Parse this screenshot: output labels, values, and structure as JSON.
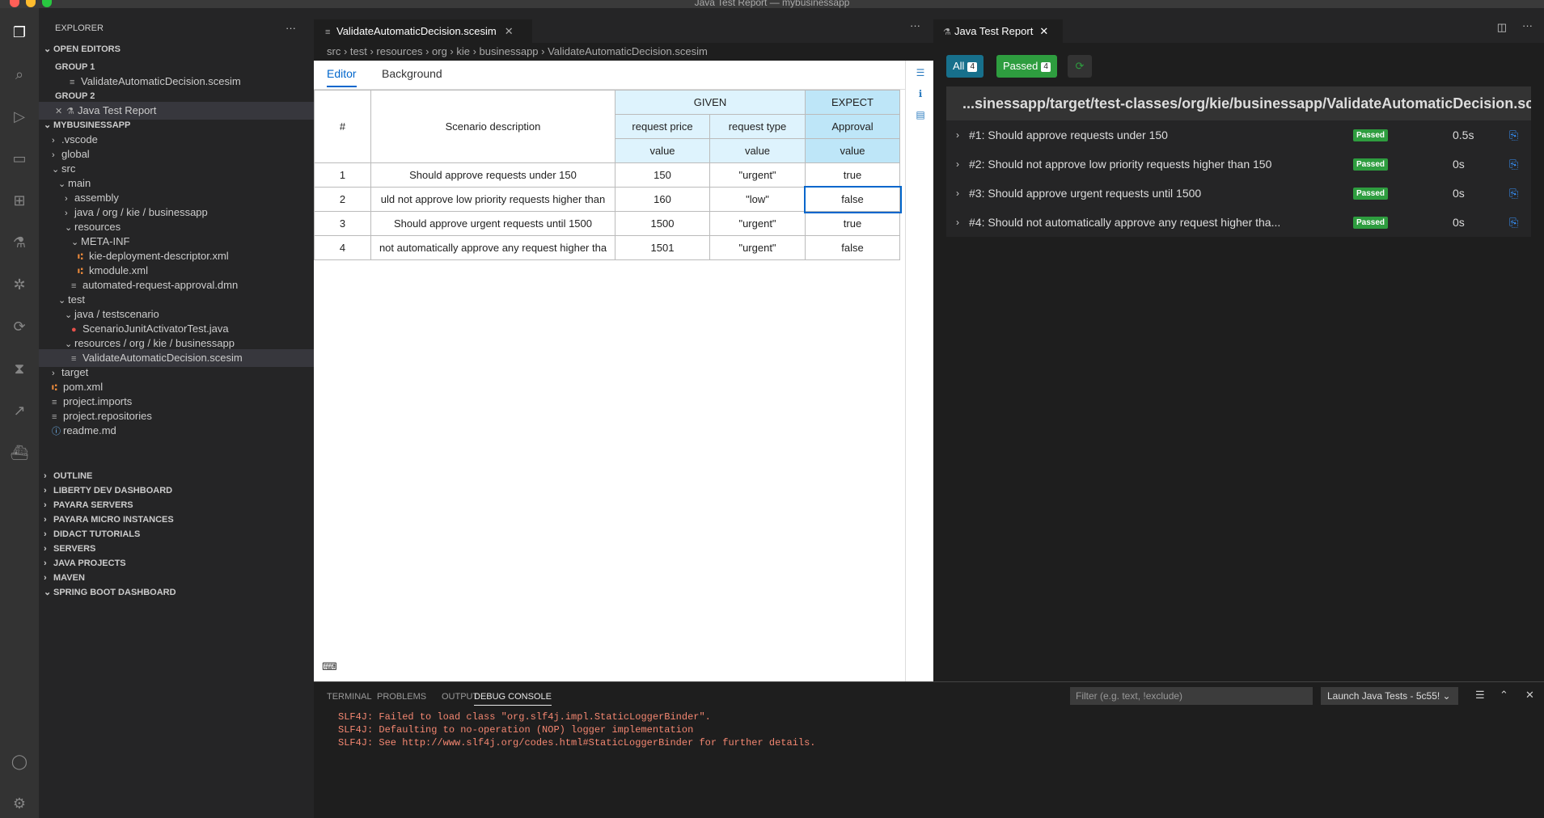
{
  "window": {
    "title": "Java Test Report — mybusinessapp"
  },
  "explorer": {
    "title": "EXPLORER",
    "more": "···",
    "open_editors": "OPEN EDITORS",
    "group1": "GROUP 1",
    "group1_file": "ValidateAutomaticDecision.scesim",
    "group2": "GROUP 2",
    "group2_file": "Java Test Report",
    "project": "MYBUSINESSAPP",
    "tree": [
      {
        "label": ".vscode",
        "indent": 1,
        "chev": "›"
      },
      {
        "label": "global",
        "indent": 1,
        "chev": "›"
      },
      {
        "label": "src",
        "indent": 1,
        "chev": "⌄"
      },
      {
        "label": "main",
        "indent": 2,
        "chev": "⌄"
      },
      {
        "label": "assembly",
        "indent": 3,
        "chev": "›"
      },
      {
        "label": "java / org / kie / businessapp",
        "indent": 3,
        "chev": "›"
      },
      {
        "label": "resources",
        "indent": 3,
        "chev": "⌄"
      },
      {
        "label": "META-INF",
        "indent": 4,
        "chev": "⌄"
      },
      {
        "label": "kie-deployment-descriptor.xml",
        "indent": 5,
        "icon": "x"
      },
      {
        "label": "kmodule.xml",
        "indent": 5,
        "icon": "x"
      },
      {
        "label": "automated-request-approval.dmn",
        "indent": 4,
        "icon": "f"
      },
      {
        "label": "test",
        "indent": 2,
        "chev": "⌄"
      },
      {
        "label": "java / testscenario",
        "indent": 3,
        "chev": "⌄"
      },
      {
        "label": "ScenarioJunitActivatorTest.java",
        "indent": 4,
        "icon": "err"
      },
      {
        "label": "resources / org / kie / businessapp",
        "indent": 3,
        "chev": "⌄"
      },
      {
        "label": "ValidateAutomaticDecision.scesim",
        "indent": 4,
        "icon": "f",
        "selected": true
      },
      {
        "label": "target",
        "indent": 1,
        "chev": "›"
      },
      {
        "label": "pom.xml",
        "indent": 1,
        "icon": "x"
      },
      {
        "label": "project.imports",
        "indent": 1,
        "icon": "f"
      },
      {
        "label": "project.repositories",
        "indent": 1,
        "icon": "f"
      },
      {
        "label": "readme.md",
        "indent": 1,
        "icon": "info"
      }
    ],
    "sections": [
      "OUTLINE",
      "LIBERTY DEV DASHBOARD",
      "PAYARA SERVERS",
      "PAYARA MICRO INSTANCES",
      "DIDACT TUTORIALS",
      "SERVERS",
      "JAVA PROJECTS",
      "MAVEN",
      "SPRING BOOT DASHBOARD"
    ]
  },
  "editor": {
    "tab": "ValidateAutomaticDecision.scesim",
    "breadcrumb": "src  ›  test  ›  resources  ›  org  ›  kie  ›  businessapp  ›  ValidateAutomaticDecision.scesim",
    "tabs": {
      "editor": "Editor",
      "background": "Background"
    },
    "grid": {
      "hash": "#",
      "desc": "Scenario description",
      "given": "GIVEN",
      "expect": "EXPECT",
      "col1": "request price",
      "col2": "request type",
      "col3": "Approval",
      "value": "value",
      "rows": [
        {
          "n": "1",
          "d": "Should approve requests under 150",
          "p": "150",
          "t": "\"urgent\"",
          "a": "true"
        },
        {
          "n": "2",
          "d": "uld not approve low priority requests higher than",
          "p": "160",
          "t": "\"low\"",
          "a": "false"
        },
        {
          "n": "3",
          "d": "Should approve urgent requests until 1500",
          "p": "1500",
          "t": "\"urgent\"",
          "a": "true"
        },
        {
          "n": "4",
          "d": "not automatically approve any request higher tha",
          "p": "1501",
          "t": "\"urgent\"",
          "a": "false"
        }
      ]
    }
  },
  "report": {
    "tab": "Java Test Report",
    "all_label": "All",
    "all_count": "4",
    "passed_label": "Passed",
    "passed_count": "4",
    "path": "...sinessapp/target/test-classes/org/kie/businessapp/ValidateAutomaticDecision.scesim/",
    "tests": [
      {
        "name": "#1: Should approve requests under 150",
        "status": "Passed",
        "dur": "0.5s"
      },
      {
        "name": "#2: Should not approve low priority requests higher than 150",
        "status": "Passed",
        "dur": "0s"
      },
      {
        "name": "#3: Should approve urgent requests until 1500",
        "status": "Passed",
        "dur": "0s"
      },
      {
        "name": "#4: Should not automatically approve any request higher tha...",
        "status": "Passed",
        "dur": "0s"
      }
    ]
  },
  "panel": {
    "tabs": [
      "TERMINAL",
      "PROBLEMS",
      "OUTPUT",
      "DEBUG CONSOLE"
    ],
    "filter_placeholder": "Filter (e.g. text, !exclude)",
    "launch": "Launch Java Tests - 5c55!",
    "lines": [
      "SLF4J: Failed to load class \"org.slf4j.impl.StaticLoggerBinder\".",
      "SLF4J: Defaulting to no-operation (NOP) logger implementation",
      "SLF4J: See http://www.slf4j.org/codes.html#StaticLoggerBinder for further details."
    ]
  },
  "colors": {
    "accent": "#0066cc",
    "passed": "#2e9d3f",
    "all": "#17708c",
    "error": "#f48771"
  }
}
